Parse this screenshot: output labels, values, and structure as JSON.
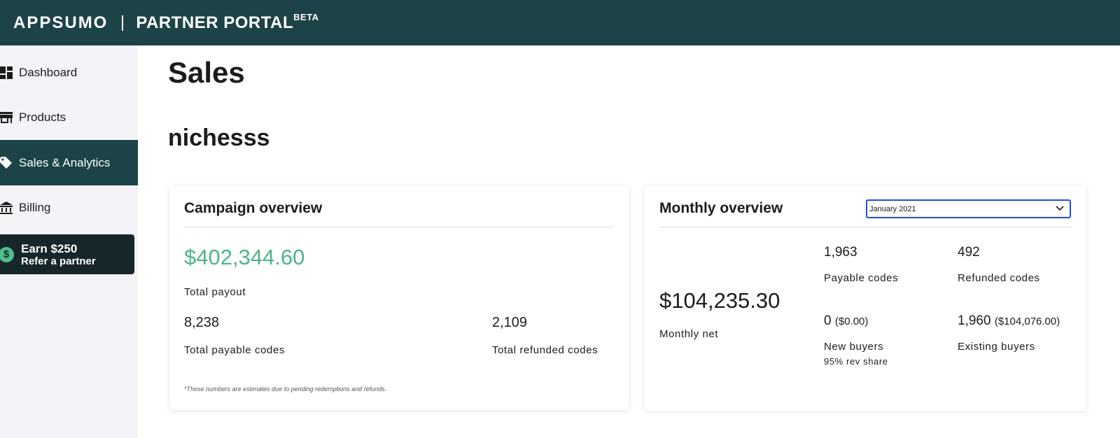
{
  "header": {
    "logo": "APPSUMO",
    "portal": "PARTNER PORTAL",
    "beta": "BETA"
  },
  "sidebar": {
    "items": [
      {
        "label": "Dashboard",
        "icon": "dashboard-icon",
        "active": false
      },
      {
        "label": "Products",
        "icon": "store-icon",
        "active": false
      },
      {
        "label": "Sales & Analytics",
        "icon": "tag-icon",
        "active": true
      },
      {
        "label": "Billing",
        "icon": "bank-icon",
        "active": false
      }
    ],
    "earn": {
      "title": "Earn $250",
      "subtitle": "Refer a partner",
      "icon": "dollar-coin-icon"
    }
  },
  "main": {
    "title": "Sales",
    "company": "nichesss",
    "campaign": {
      "title": "Campaign overview",
      "total_payout": "$402,344.60",
      "total_payout_label": "Total payout",
      "payable_codes": "8,238",
      "payable_codes_label": "Total payable codes",
      "refunded_codes": "2,109",
      "refunded_codes_label": "Total refunded codes",
      "note": "*These numbers are estimates due to pending redemptions and refunds."
    },
    "monthly": {
      "title": "Monthly overview",
      "selected_month": "January 2021",
      "net": "$104,235.30",
      "net_label": "Monthly net",
      "payable_codes": "1,963",
      "payable_codes_label": "Payable codes",
      "refunded_codes": "492",
      "refunded_codes_label": "Refunded codes",
      "new_buyers": "0",
      "new_buyers_amount": "($0.00)",
      "new_buyers_label": "New buyers",
      "new_buyers_note": "95% rev share",
      "existing_buyers": "1,960",
      "existing_buyers_amount": "($104,076.00)",
      "existing_buyers_label": "Existing buyers"
    }
  },
  "colors": {
    "header_bg": "#1c4348",
    "accent_green": "#4db587",
    "select_border": "#1f4fd8",
    "earn_bg": "#16262b"
  }
}
